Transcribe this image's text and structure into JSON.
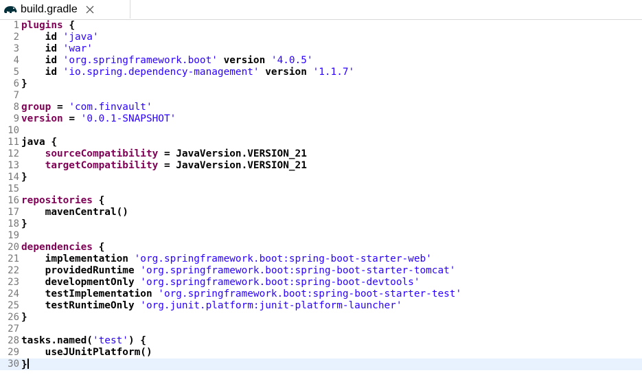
{
  "tab": {
    "title": "build.gradle",
    "icon": "gradle-elephant-icon",
    "close_icon": "close-icon"
  },
  "editor": {
    "lines": [
      {
        "n": "1",
        "segs": [
          {
            "t": "plugins",
            "c": "kw"
          },
          {
            "t": " {",
            "c": "txt"
          }
        ]
      },
      {
        "n": "2",
        "segs": [
          {
            "t": "    id ",
            "c": "txt"
          },
          {
            "t": "'java'",
            "c": "str"
          }
        ]
      },
      {
        "n": "3",
        "segs": [
          {
            "t": "    id ",
            "c": "txt"
          },
          {
            "t": "'war'",
            "c": "str"
          }
        ]
      },
      {
        "n": "4",
        "segs": [
          {
            "t": "    id ",
            "c": "txt"
          },
          {
            "t": "'org.springframework.boot'",
            "c": "str"
          },
          {
            "t": " version ",
            "c": "txt"
          },
          {
            "t": "'4.0.5'",
            "c": "str"
          }
        ]
      },
      {
        "n": "5",
        "segs": [
          {
            "t": "    id ",
            "c": "txt"
          },
          {
            "t": "'io.spring.dependency-management'",
            "c": "str"
          },
          {
            "t": " version ",
            "c": "txt"
          },
          {
            "t": "'1.1.7'",
            "c": "str"
          }
        ]
      },
      {
        "n": "6",
        "segs": [
          {
            "t": "}",
            "c": "txt"
          }
        ]
      },
      {
        "n": "7",
        "segs": []
      },
      {
        "n": "8",
        "segs": [
          {
            "t": "group",
            "c": "kw"
          },
          {
            "t": " = ",
            "c": "txt"
          },
          {
            "t": "'com.finvault'",
            "c": "str"
          }
        ]
      },
      {
        "n": "9",
        "segs": [
          {
            "t": "version",
            "c": "kw"
          },
          {
            "t": " = ",
            "c": "txt"
          },
          {
            "t": "'0.0.1-SNAPSHOT'",
            "c": "str"
          }
        ]
      },
      {
        "n": "10",
        "segs": []
      },
      {
        "n": "11",
        "segs": [
          {
            "t": "java",
            "c": "txt"
          },
          {
            "t": " {",
            "c": "txt"
          }
        ]
      },
      {
        "n": "12",
        "segs": [
          {
            "t": "    ",
            "c": "txt"
          },
          {
            "t": "sourceCompatibility",
            "c": "kw"
          },
          {
            "t": " = JavaVersion.VERSION_21",
            "c": "txt"
          }
        ]
      },
      {
        "n": "13",
        "segs": [
          {
            "t": "    ",
            "c": "txt"
          },
          {
            "t": "targetCompatibility",
            "c": "kw"
          },
          {
            "t": " = JavaVersion.VERSION_21",
            "c": "txt"
          }
        ]
      },
      {
        "n": "14",
        "segs": [
          {
            "t": "}",
            "c": "txt"
          }
        ]
      },
      {
        "n": "15",
        "segs": []
      },
      {
        "n": "16",
        "segs": [
          {
            "t": "repositories",
            "c": "kw"
          },
          {
            "t": " {",
            "c": "txt"
          }
        ]
      },
      {
        "n": "17",
        "segs": [
          {
            "t": "    mavenCentral()",
            "c": "txt"
          }
        ]
      },
      {
        "n": "18",
        "segs": [
          {
            "t": "}",
            "c": "txt"
          }
        ]
      },
      {
        "n": "19",
        "segs": []
      },
      {
        "n": "20",
        "segs": [
          {
            "t": "dependencies",
            "c": "kw"
          },
          {
            "t": " {",
            "c": "txt"
          }
        ]
      },
      {
        "n": "21",
        "segs": [
          {
            "t": "    implementation ",
            "c": "txt"
          },
          {
            "t": "'org.springframework.boot:spring-boot-starter-web'",
            "c": "str"
          }
        ]
      },
      {
        "n": "22",
        "segs": [
          {
            "t": "    providedRuntime ",
            "c": "txt"
          },
          {
            "t": "'org.springframework.boot:spring-boot-starter-tomcat'",
            "c": "str"
          }
        ]
      },
      {
        "n": "23",
        "segs": [
          {
            "t": "    developmentOnly ",
            "c": "txt"
          },
          {
            "t": "'org.springframework.boot:spring-boot-devtools'",
            "c": "str"
          }
        ]
      },
      {
        "n": "24",
        "segs": [
          {
            "t": "    testImplementation ",
            "c": "txt"
          },
          {
            "t": "'org.springframework.boot:spring-boot-starter-test'",
            "c": "str"
          }
        ]
      },
      {
        "n": "25",
        "segs": [
          {
            "t": "    testRuntimeOnly ",
            "c": "txt"
          },
          {
            "t": "'org.junit.platform:junit-platform-launcher'",
            "c": "str"
          }
        ]
      },
      {
        "n": "26",
        "segs": [
          {
            "t": "}",
            "c": "txt"
          }
        ]
      },
      {
        "n": "27",
        "segs": []
      },
      {
        "n": "28",
        "segs": [
          {
            "t": "tasks.named(",
            "c": "txt"
          },
          {
            "t": "'test'",
            "c": "str"
          },
          {
            "t": ") {",
            "c": "txt"
          }
        ]
      },
      {
        "n": "29",
        "segs": [
          {
            "t": "    useJUnitPlatform()",
            "c": "txt"
          }
        ]
      },
      {
        "n": "30",
        "segs": [
          {
            "t": "}",
            "c": "txt"
          }
        ],
        "current": true,
        "caret": true
      }
    ]
  },
  "colors": {
    "keyword": "#7f0055",
    "string": "#2a00ff",
    "line_number": "#787878",
    "current_line": "#e8f2fe"
  }
}
